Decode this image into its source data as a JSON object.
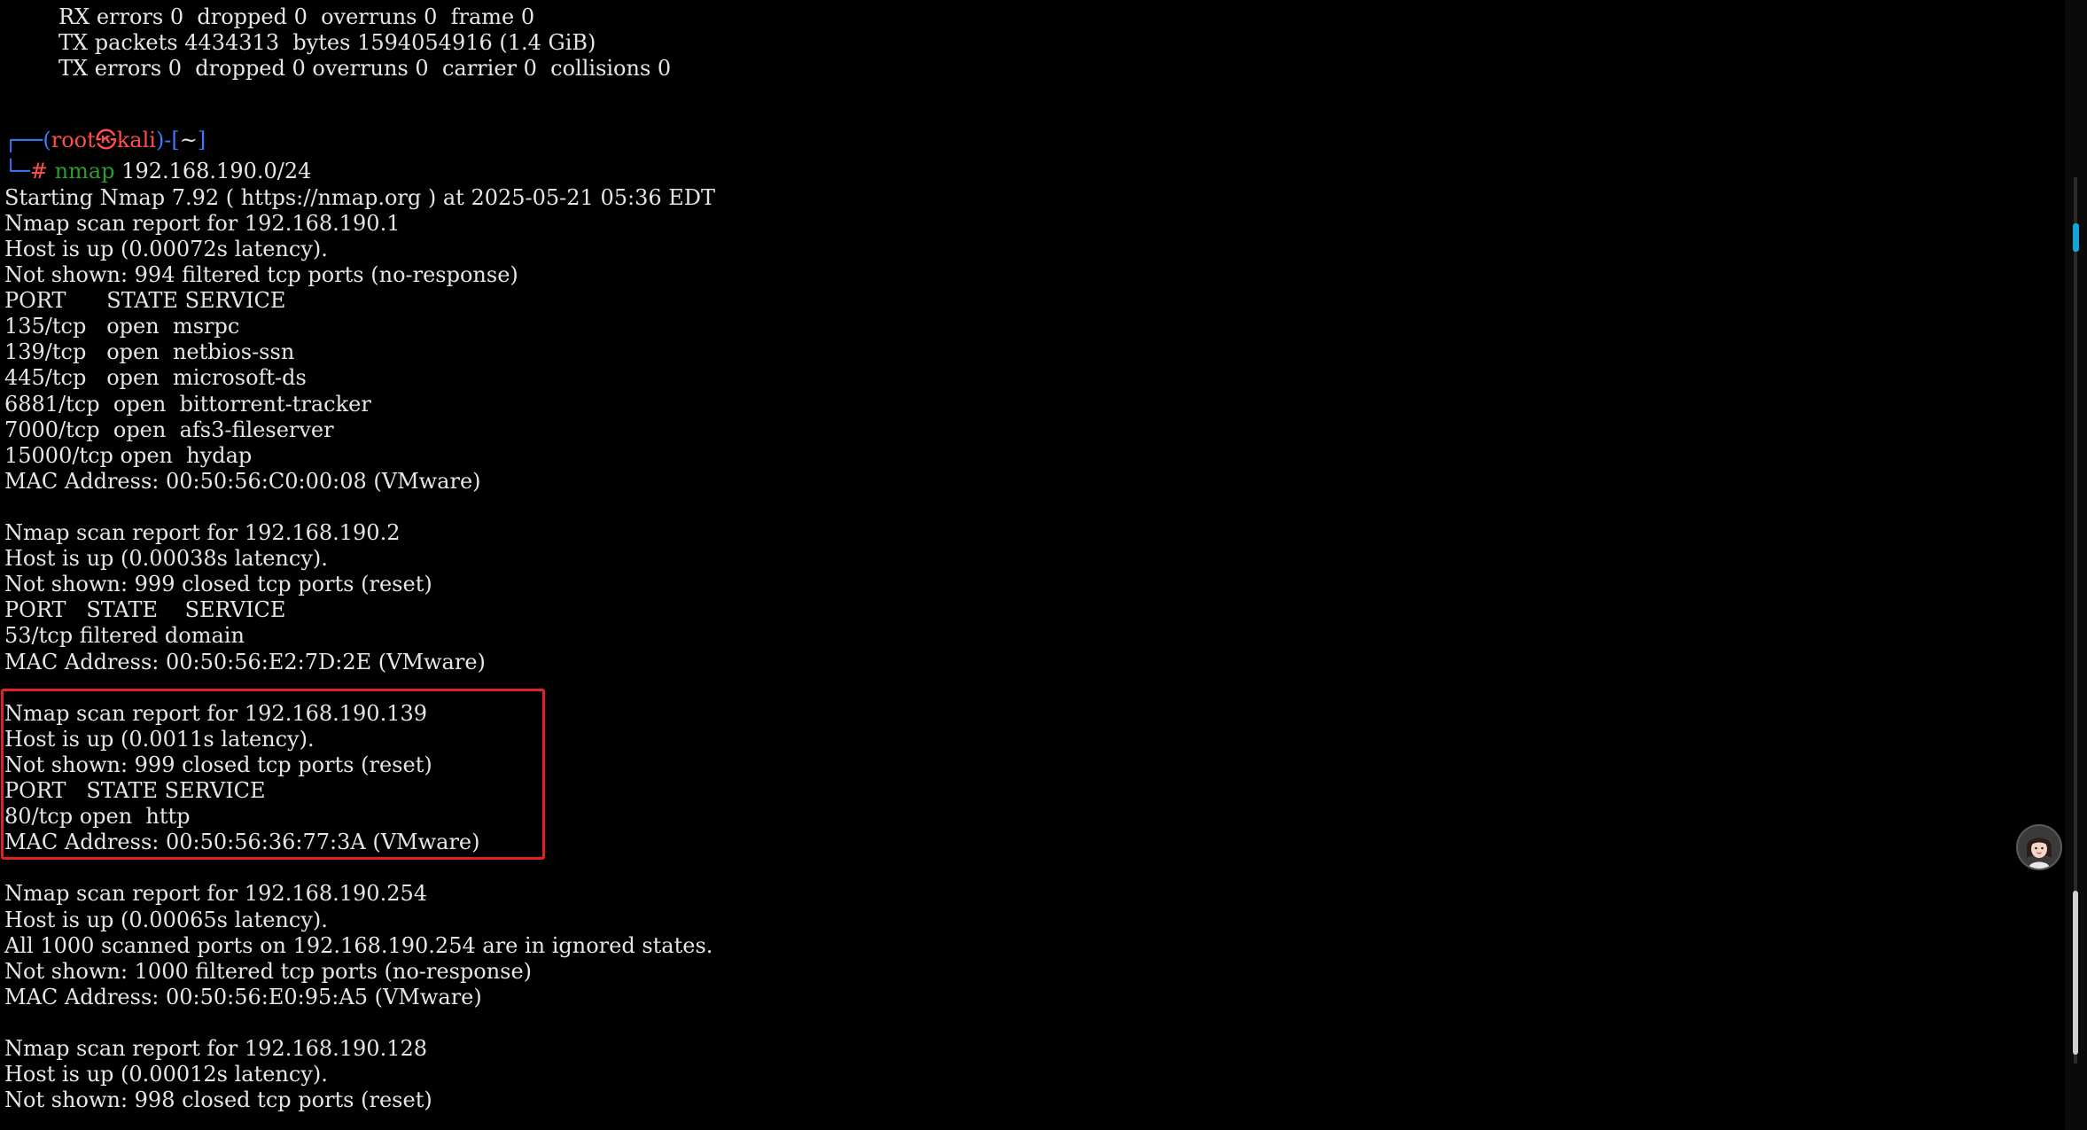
{
  "terminal": {
    "lines": [
      "        RX errors 0  dropped 0  overruns 0  frame 0",
      "        TX packets 4434313  bytes 1594054916 (1.4 GiB)",
      "        TX errors 0  dropped 0 overruns 0  carrier 0  collisions 0",
      "",
      "",
      "",
      "",
      "Starting Nmap 7.92 ( https://nmap.org ) at 2025-05-21 05:36 EDT",
      "Nmap scan report for 192.168.190.1",
      "Host is up (0.00072s latency).",
      "Not shown: 994 filtered tcp ports (no-response)",
      "PORT      STATE SERVICE",
      "135/tcp   open  msrpc",
      "139/tcp   open  netbios-ssn",
      "445/tcp   open  microsoft-ds",
      "6881/tcp  open  bittorrent-tracker",
      "7000/tcp  open  afs3-fileserver",
      "15000/tcp open  hydap",
      "MAC Address: 00:50:56:C0:00:08 (VMware)",
      "",
      "Nmap scan report for 192.168.190.2",
      "Host is up (0.00038s latency).",
      "Not shown: 999 closed tcp ports (reset)",
      "PORT   STATE    SERVICE",
      "53/tcp filtered domain",
      "MAC Address: 00:50:56:E2:7D:2E (VMware)",
      "",
      "Nmap scan report for 192.168.190.139",
      "Host is up (0.0011s latency).",
      "Not shown: 999 closed tcp ports (reset)",
      "PORT   STATE SERVICE",
      "80/tcp open  http",
      "MAC Address: 00:50:56:36:77:3A (VMware)",
      "",
      "Nmap scan report for 192.168.190.254",
      "Host is up (0.00065s latency).",
      "All 1000 scanned ports on 192.168.190.254 are in ignored states.",
      "Not shown: 1000 filtered tcp ports (no-response)",
      "MAC Address: 00:50:56:E0:95:A5 (VMware)",
      "",
      "Nmap scan report for 192.168.190.128",
      "Host is up (0.00012s latency).",
      "Not shown: 998 closed tcp ports (reset)"
    ],
    "prompt": {
      "line1_prefix": "┌──(",
      "user": "root㉿kali",
      "line1_mid": ")-[",
      "path": "~",
      "line1_suffix": "]",
      "line2_prefix": "└─",
      "hash": "#",
      "command": "nmap",
      "args": " 192.168.190.0/24"
    }
  },
  "colors": {
    "background": "#000000",
    "text": "#e6e6e6",
    "prompt_bracket": "#3b78ff",
    "prompt_user": "#ff4d4d",
    "prompt_command": "#2a9d2a",
    "highlight_border": "#e0231f",
    "scroll_marker": "#12a6d8"
  },
  "icons": {
    "avatar": "avatar-icon"
  }
}
